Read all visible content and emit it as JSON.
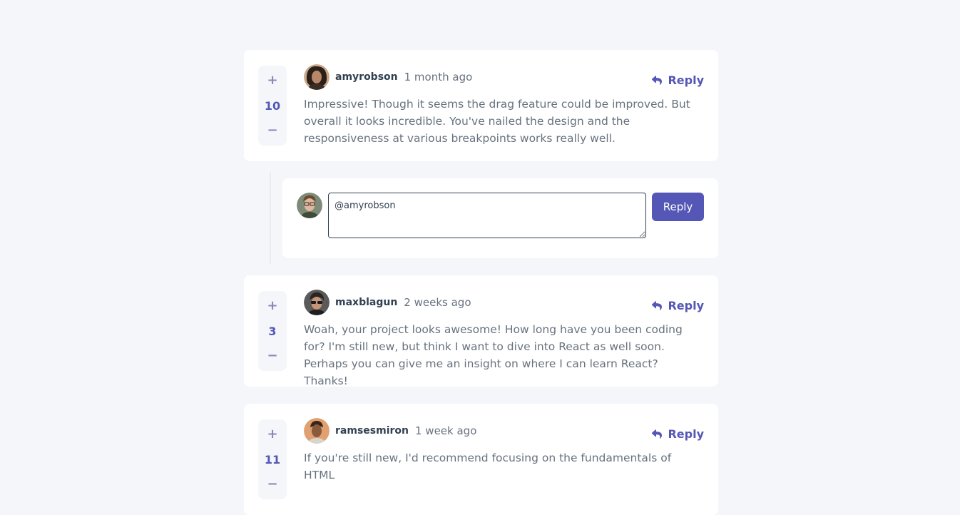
{
  "comments": [
    {
      "score": "10",
      "username": "amyrobson",
      "time": "1 month ago",
      "reply_label": "Reply",
      "body": "Impressive! Though it seems the drag feature could be improved. But overall it looks incredible. You've nailed the design and the responsiveness at various breakpoints works really well."
    },
    {
      "score": "3",
      "username": "maxblagun",
      "time": "2 weeks ago",
      "reply_label": "Reply",
      "body": "Woah, your project looks awesome! How long have you been coding for? I'm still new, but think I want to dive into React as well soon. Perhaps you can give me an insight on where I can learn React? Thanks!"
    },
    {
      "score": "11",
      "username": "ramsesmiron",
      "time": "1 week ago",
      "reply_label": "Reply",
      "body": "If you're still new, I'd recommend focusing on the fundamentals of HTML"
    }
  ],
  "reply_form": {
    "value": "@amyrobson",
    "send_label": "Reply"
  },
  "vote": {
    "plus": "+",
    "minus": "−"
  },
  "colors": {
    "background": "#f5f6fa",
    "accent": "#5457b6",
    "text": "#67727e",
    "username": "#324152"
  },
  "icons": [
    "reply-arrow-icon",
    "avatar-amyrobson",
    "avatar-juliusomo",
    "avatar-maxblagun",
    "avatar-ramsesmiron"
  ]
}
